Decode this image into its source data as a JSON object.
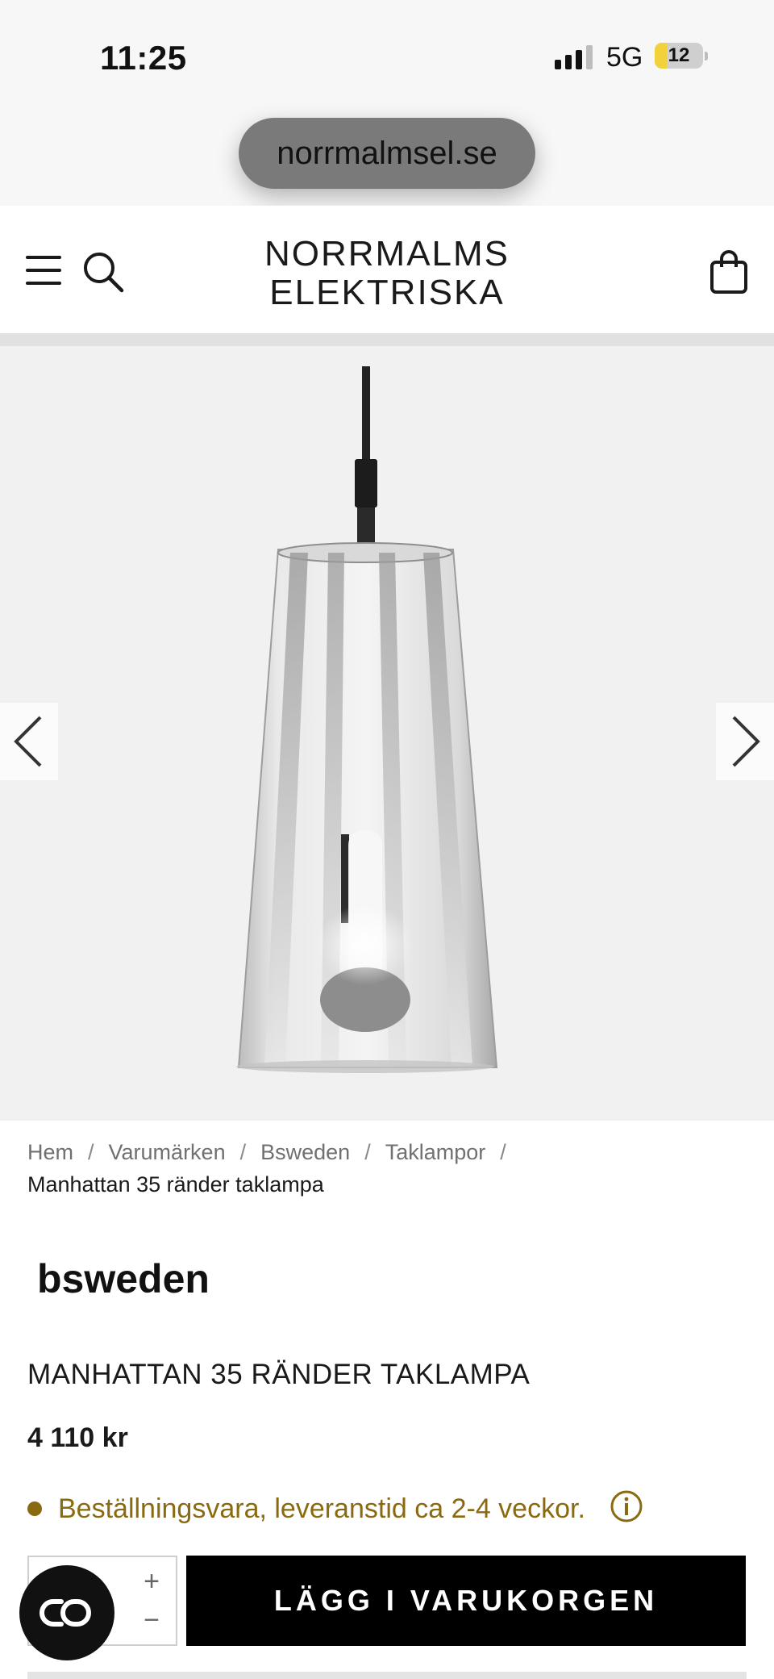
{
  "status_bar": {
    "time": "11:25",
    "network": "5G",
    "battery_level": "12",
    "battery_fraction": 0.12,
    "battery_color": "#f2d23a"
  },
  "browser": {
    "url": "norrmalmsel.se"
  },
  "header": {
    "logo_line1": "NORRMALMS",
    "logo_line2": "ELEKTRISKA",
    "menu_icon": "hamburger-icon",
    "search_icon": "search-icon",
    "cart_icon": "shopping-bag-icon"
  },
  "gallery": {
    "prev_icon": "chevron-left-icon",
    "next_icon": "chevron-right-icon"
  },
  "breadcrumb": {
    "items": [
      "Hem",
      "Varumärken",
      "Bsweden",
      "Taklampor"
    ],
    "separator": "/",
    "current": "Manhattan 35 ränder taklampa"
  },
  "product": {
    "brand": "bsweden",
    "title": "MANHATTAN 35 RÄNDER TAKLAMPA",
    "price": "4 110 kr",
    "availability": "Beställningsvara, leveranstid ca 2-4 veckor.",
    "availability_color": "#8a6a10",
    "quantity": "",
    "qty_plus": "+",
    "qty_minus": "−",
    "add_to_cart": "LÄGG I VARUKORGEN"
  },
  "chat": {
    "icon": "chat-link-icon"
  }
}
